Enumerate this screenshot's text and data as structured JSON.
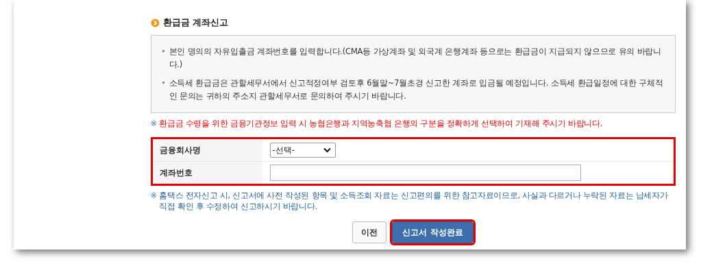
{
  "section_title": "환급금 계좌신고",
  "notices": [
    "본인 명의의 자유입출금 계좌번호를 입력합니다.(CMA등 가상계좌 및 외국계 은행계좌 등으로는 환급금이 지급되지 않으므로 유의 바랍니다.)",
    "소득세 환급금은 관할세무서에서 신고적정여부 검토후 6월말~7월초경 신고한 계좌로 입금될 예정입니다. 소득세 환급일정에 대한 구체적인 문의는 귀하의 주소지 관할세무서로 문의하여 주시기 바랍니다."
  ],
  "warning": {
    "mark": "※",
    "text": "환급금 수령을 위한 금융기관정보 입력 시 농협은행과 지역농축협 은행의 구분을 정확하게 선택하여 기재해 주시기 바랍니다."
  },
  "form": {
    "highlighted": true,
    "rows": [
      {
        "kind": "select",
        "label": "금융회사명",
        "value": "-선택-"
      },
      {
        "kind": "text",
        "label": "계좌번호"
      }
    ]
  },
  "note": {
    "mark": "※",
    "text": "홈택스 전자신고 시, 신고서에 사전 작성된 항목 및 소득조회 자료는 신고편의를 위한 참고자료이므로, 사실과 다르거나 누락된 자료는 납세자가 직접 확인 후 수정하여 신고하시기 바랍니다."
  },
  "buttons": [
    {
      "label": "이전",
      "kind": "secondary",
      "highlighted": false
    },
    {
      "label": "신고서 작성완료",
      "kind": "primary",
      "highlighted": true
    }
  ]
}
